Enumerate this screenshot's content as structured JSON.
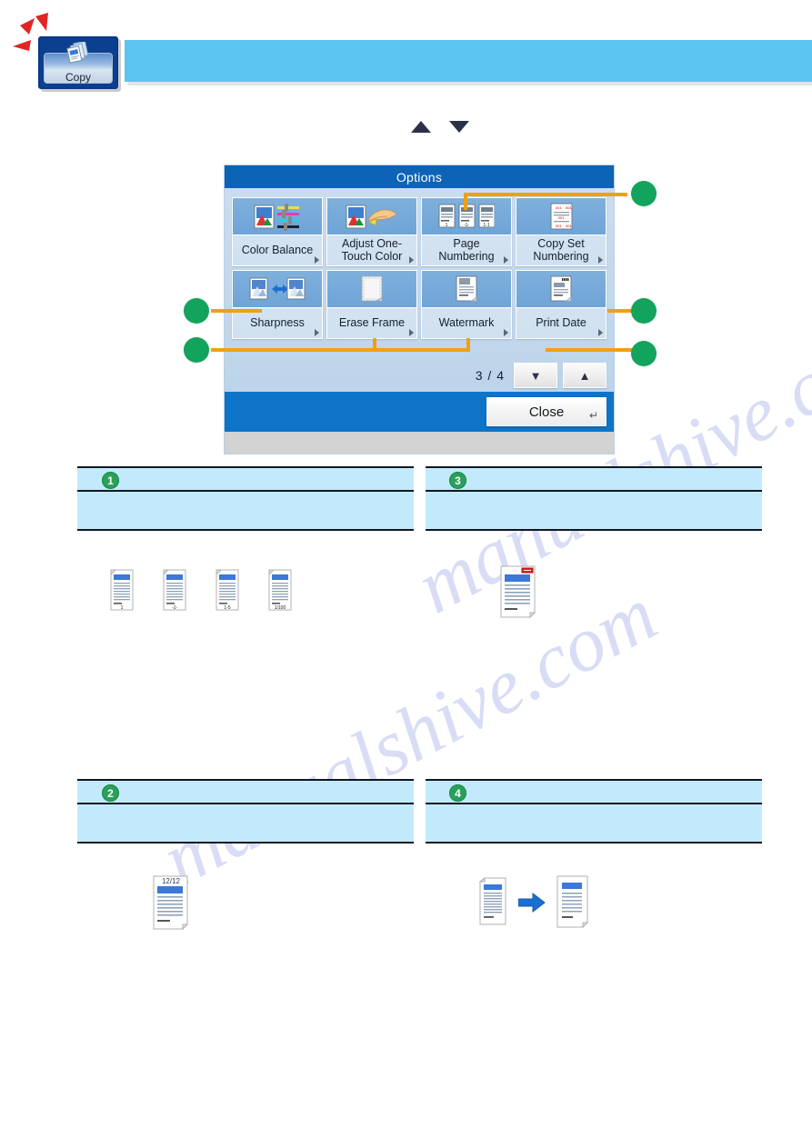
{
  "page": {
    "tab": {
      "label": "Copy",
      "icon": "copy-documents-icon"
    },
    "banner": {
      "text": ""
    },
    "scroll_hint": {
      "up": "▲",
      "down": "▼"
    }
  },
  "dialog": {
    "title": "Options",
    "page_indicator": "3 / 4",
    "pager": {
      "prev_icon": "▼",
      "next_icon": "▲"
    },
    "close_label": "Close",
    "close_corner_icon": "↵",
    "buttons": [
      {
        "label": "Color Balance",
        "icon": "color-balance-icon",
        "arrow": true
      },
      {
        "label": "Adjust One-\nTouch Color",
        "icon": "adjust-one-touch-color-icon",
        "arrow": true
      },
      {
        "label": "Page\nNumbering",
        "icon": "page-numbering-icon",
        "arrow": true
      },
      {
        "label": "Copy Set\nNumbering",
        "icon": "copy-set-numbering-icon",
        "arrow": true
      },
      {
        "label": "Sharpness",
        "icon": "sharpness-icon",
        "arrow": true
      },
      {
        "label": "Erase Frame",
        "icon": "erase-frame-icon",
        "arrow": true
      },
      {
        "label": "Watermark",
        "icon": "watermark-icon",
        "arrow": true
      },
      {
        "label": "Print Date",
        "icon": "print-date-icon",
        "arrow": true
      }
    ]
  },
  "callouts": [
    {
      "id": "c1",
      "target": "Page Numbering"
    },
    {
      "id": "c2",
      "target": "Sharpness"
    },
    {
      "id": "c3",
      "target": "Print Date"
    },
    {
      "id": "c4",
      "target": "Erase Frame / Watermark"
    }
  ],
  "panels": [
    {
      "number": "1",
      "head": "",
      "body": "",
      "figures": {
        "type": "page-numbering-samples",
        "captions": [
          "1",
          "-1-",
          "1-5",
          "1/100"
        ]
      }
    },
    {
      "number": "3",
      "head": "",
      "body": "",
      "figures": {
        "type": "print-date-sample",
        "captions": []
      }
    },
    {
      "number": "2",
      "head": "",
      "body": "",
      "figures": {
        "type": "copy-set-numbering-sample",
        "captions": [
          "12/12"
        ]
      }
    },
    {
      "number": "4",
      "head": "",
      "body": "",
      "figures": {
        "type": "erase-frame-sample",
        "captions": []
      }
    }
  ],
  "watermark": {
    "line1": "manualshive.com",
    "line2": "manualshive.com"
  },
  "colors": {
    "banner": "#5bc4f1",
    "dialog_title": "#0d63b5",
    "dialog_footer": "#0d74c8",
    "callout_green": "#12a35c",
    "leader_orange": "#f0a010",
    "panel_blue": "#c3eafc",
    "flash_red": "#e02525",
    "doc_band_blue": "#3b78d8"
  }
}
